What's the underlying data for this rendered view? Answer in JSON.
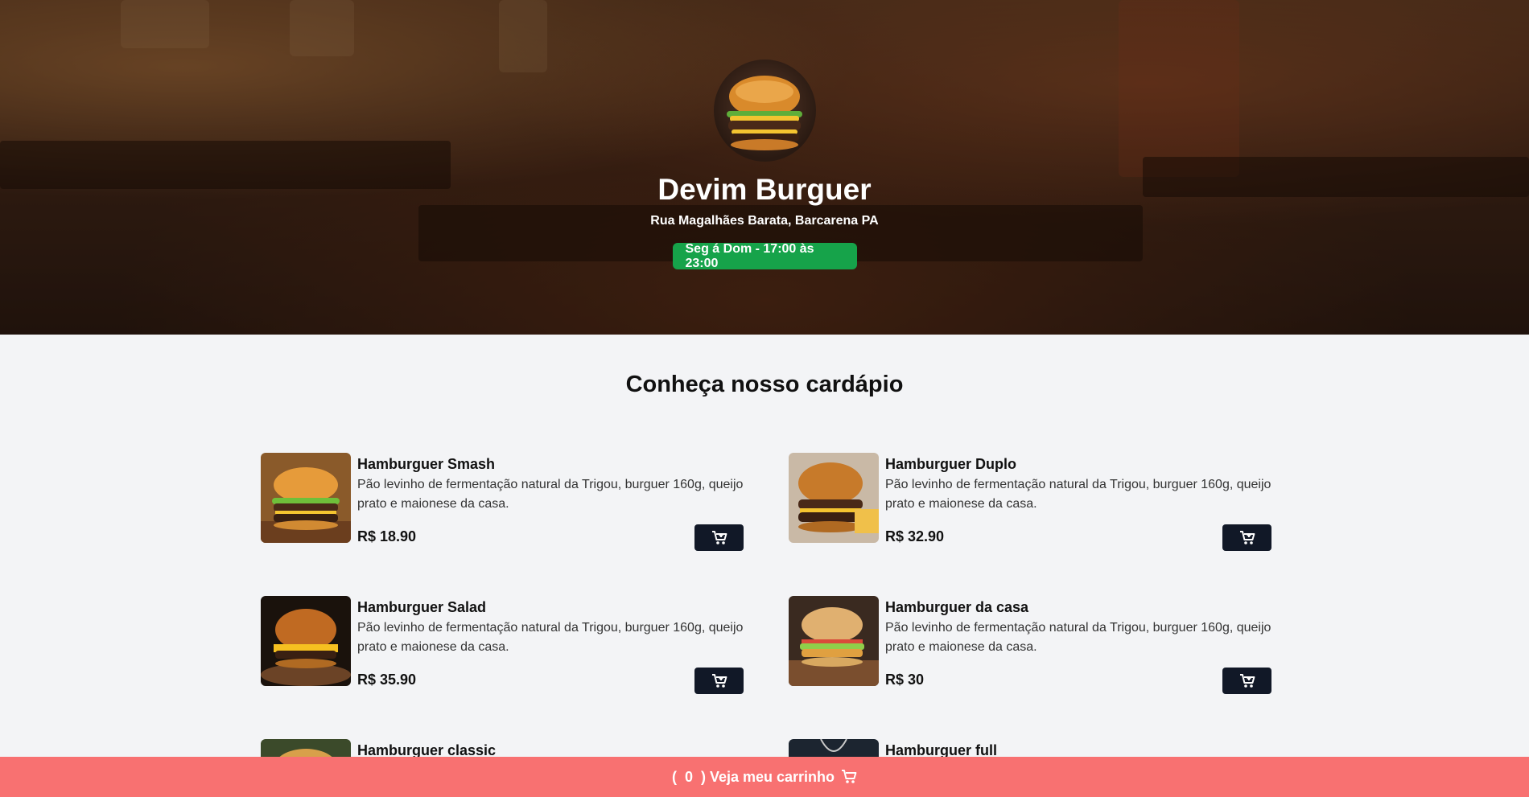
{
  "header": {
    "restaurant_name": "Devim Burguer",
    "address": "Rua Magalhães Barata, Barcarena PA",
    "hours": "Seg á Dom - 17:00 às 23:00"
  },
  "menu": {
    "title": "Conheça nosso cardápio",
    "items": [
      {
        "name": "Hamburguer Smash",
        "description": "Pão levinho de fermentação natural da Trigou, burguer 160g, queijo prato e maionese da casa.",
        "price": "R$ 18.90"
      },
      {
        "name": "Hamburguer Duplo",
        "description": "Pão levinho de fermentação natural da Trigou, burguer 160g, queijo prato e maionese da casa.",
        "price": "R$ 32.90"
      },
      {
        "name": "Hamburguer Salad",
        "description": "Pão levinho de fermentação natural da Trigou, burguer 160g, queijo prato e maionese da casa.",
        "price": "R$ 35.90"
      },
      {
        "name": "Hamburguer da casa",
        "description": "Pão levinho de fermentação natural da Trigou, burguer 160g, queijo prato e maionese da casa.",
        "price": "R$ 30"
      },
      {
        "name": "Hamburguer classic",
        "description": "",
        "price": ""
      },
      {
        "name": "Hamburguer full",
        "description": "",
        "price": ""
      }
    ]
  },
  "cart": {
    "open_paren": "(",
    "count": "0",
    "close_label": ") Veja meu carrinho"
  },
  "colors": {
    "hours_badge": "#16a34a",
    "cart_button": "#111827",
    "footer": "#f87171",
    "background": "#f3f4f6"
  },
  "icons": {
    "cart": "cart-plus-icon",
    "footer_cart": "cart-icon"
  }
}
